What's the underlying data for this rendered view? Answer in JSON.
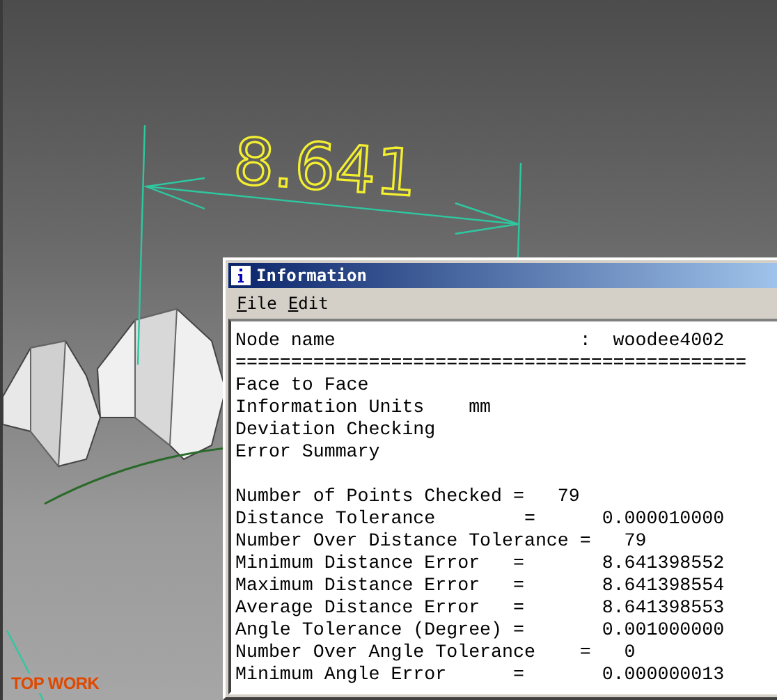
{
  "viewport": {
    "dimension_value": "8.641",
    "view_label": "TOP WORK"
  },
  "info_window": {
    "title": "Information",
    "menu": [
      "File",
      "Edit"
    ],
    "paragraphs": [
      {
        "lines": [
          "Node name                      :  woodee4002",
          "==============================================",
          "Face to Face",
          "Information Units    mm",
          "Deviation Checking",
          "Error Summary"
        ]
      },
      {
        "lines": [
          "Number of Points Checked =   79",
          "Distance Tolerance        =      0.000010000",
          "Number Over Distance Tolerance =   79",
          "Minimum Distance Error   =       8.641398552",
          "Maximum Distance Error   =       8.641398554",
          "Average Distance Error   =       8.641398553",
          "Angle Tolerance (Degree) =       0.001000000",
          "Number Over Angle Tolerance    =   0",
          "Minimum Angle Error      =       0.000000013"
        ]
      }
    ]
  }
}
